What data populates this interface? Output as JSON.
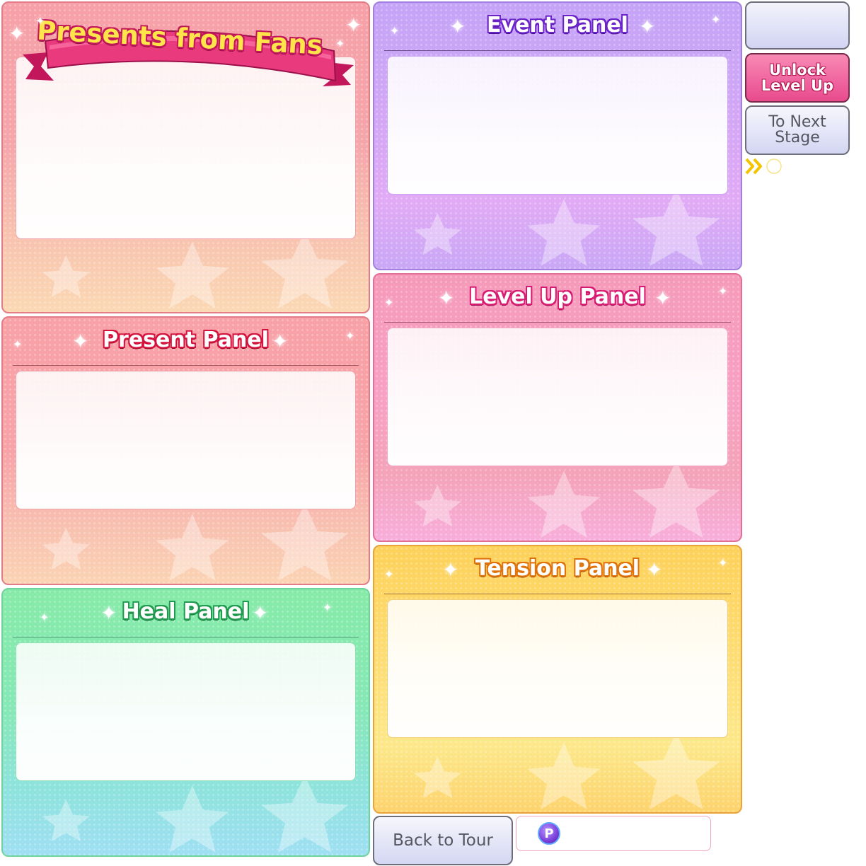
{
  "panels": {
    "fans": {
      "title": "Presents from Fans"
    },
    "present": {
      "title": "Present Panel"
    },
    "heal": {
      "title": "Heal Panel"
    },
    "event": {
      "title": "Event Panel"
    },
    "level_up": {
      "title": "Level Up Panel"
    },
    "tension": {
      "title": "Tension Panel"
    }
  },
  "side_buttons": {
    "blank_label": "",
    "unlock_label": "Unlock\nLevel Up",
    "next_label": "To Next\nStage"
  },
  "bottom": {
    "back_label": "Back to Tour",
    "points_icon_glyph": "P",
    "points_value": ""
  },
  "icons": {
    "sparkle": "sparkle-icon",
    "next_arrows": "double-chevron-right-icon",
    "points": "p-coin-icon"
  },
  "colors": {
    "fans": "#f7a0a8",
    "present": "#f8a2a8",
    "heal": "#86eaa8",
    "event": "#c4a4f7",
    "level_up": "#f69ab9",
    "tension": "#fdd15a",
    "unlock_button": "#f066a0",
    "next_arrows": "#f5c400"
  }
}
